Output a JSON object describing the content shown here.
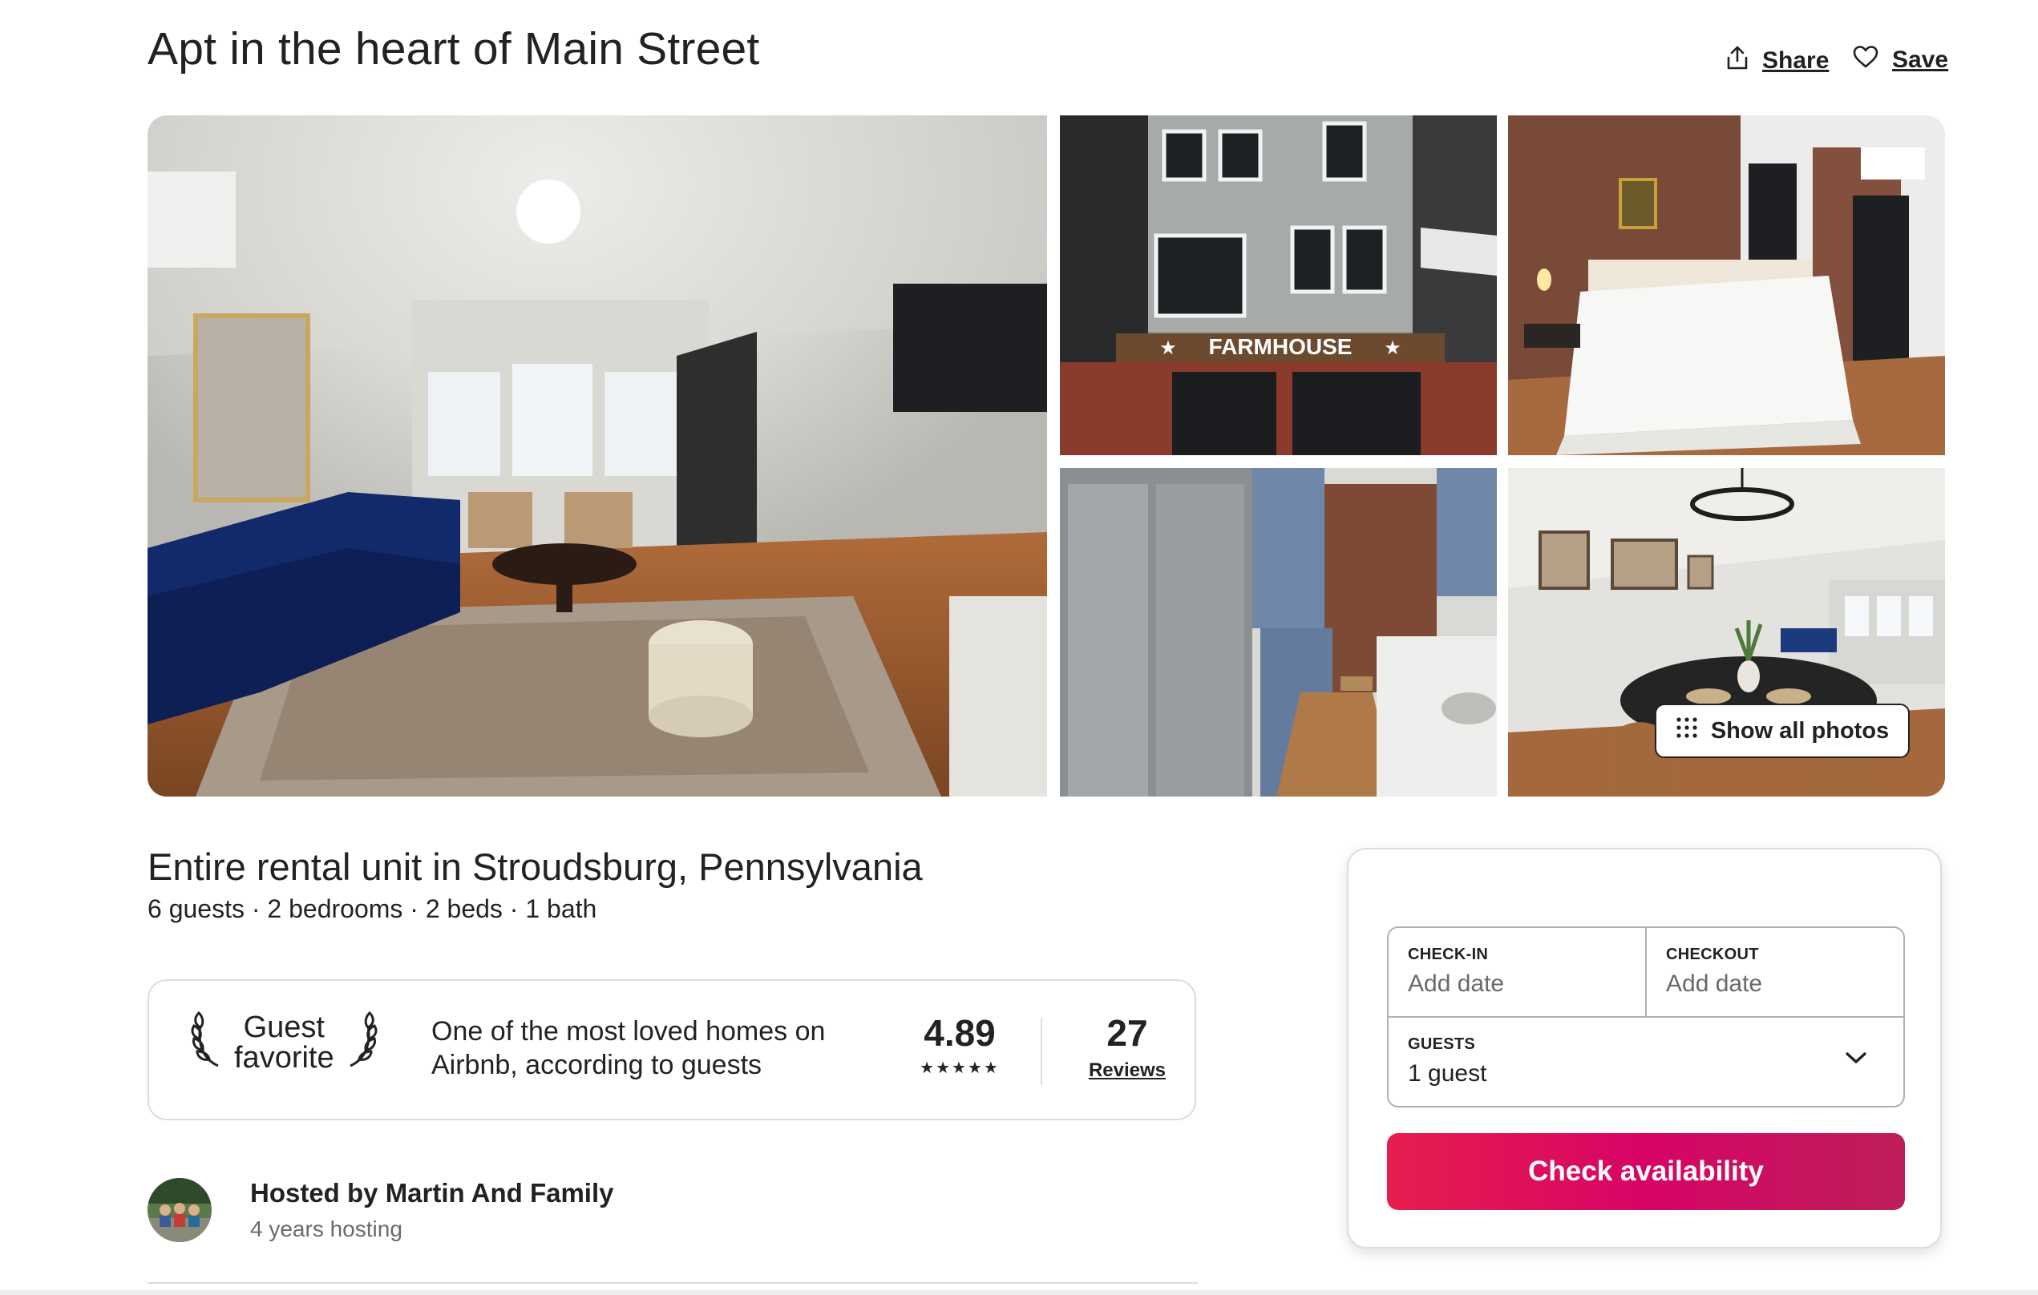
{
  "header": {
    "title": "Apt in the heart of Main Street",
    "share_label": "Share",
    "save_label": "Save"
  },
  "gallery": {
    "show_all_label": "Show all photos",
    "photo_2_sign": "FARMHOUSE"
  },
  "listing": {
    "subtitle": "Entire rental unit in Stroudsburg, Pennsylvania",
    "facts": "6 guests · 2 bedrooms · 2 beds · 1 bath"
  },
  "guest_favorite": {
    "badge_line1": "Guest",
    "badge_line2": "favorite",
    "description": "One of the most loved homes on Airbnb, according to guests",
    "rating": "4.89",
    "stars": "★★★★★",
    "review_count": "27",
    "reviews_label": "Reviews"
  },
  "host": {
    "name": "Hosted by Martin And Family",
    "years": "4 years hosting"
  },
  "booking": {
    "checkin_label": "CHECK-IN",
    "checkin_value": "Add date",
    "checkout_label": "CHECKOUT",
    "checkout_value": "Add date",
    "guests_label": "GUESTS",
    "guests_value": "1 guest",
    "cta_label": "Check availability"
  },
  "colors": {
    "accent": "#e61e4d",
    "text": "#222222",
    "muted": "#6a6a6a",
    "border": "#dddddd"
  },
  "icons": [
    "share-icon",
    "heart-icon",
    "grid-dots-icon",
    "laurel-left-icon",
    "laurel-right-icon",
    "chevron-down-icon"
  ]
}
